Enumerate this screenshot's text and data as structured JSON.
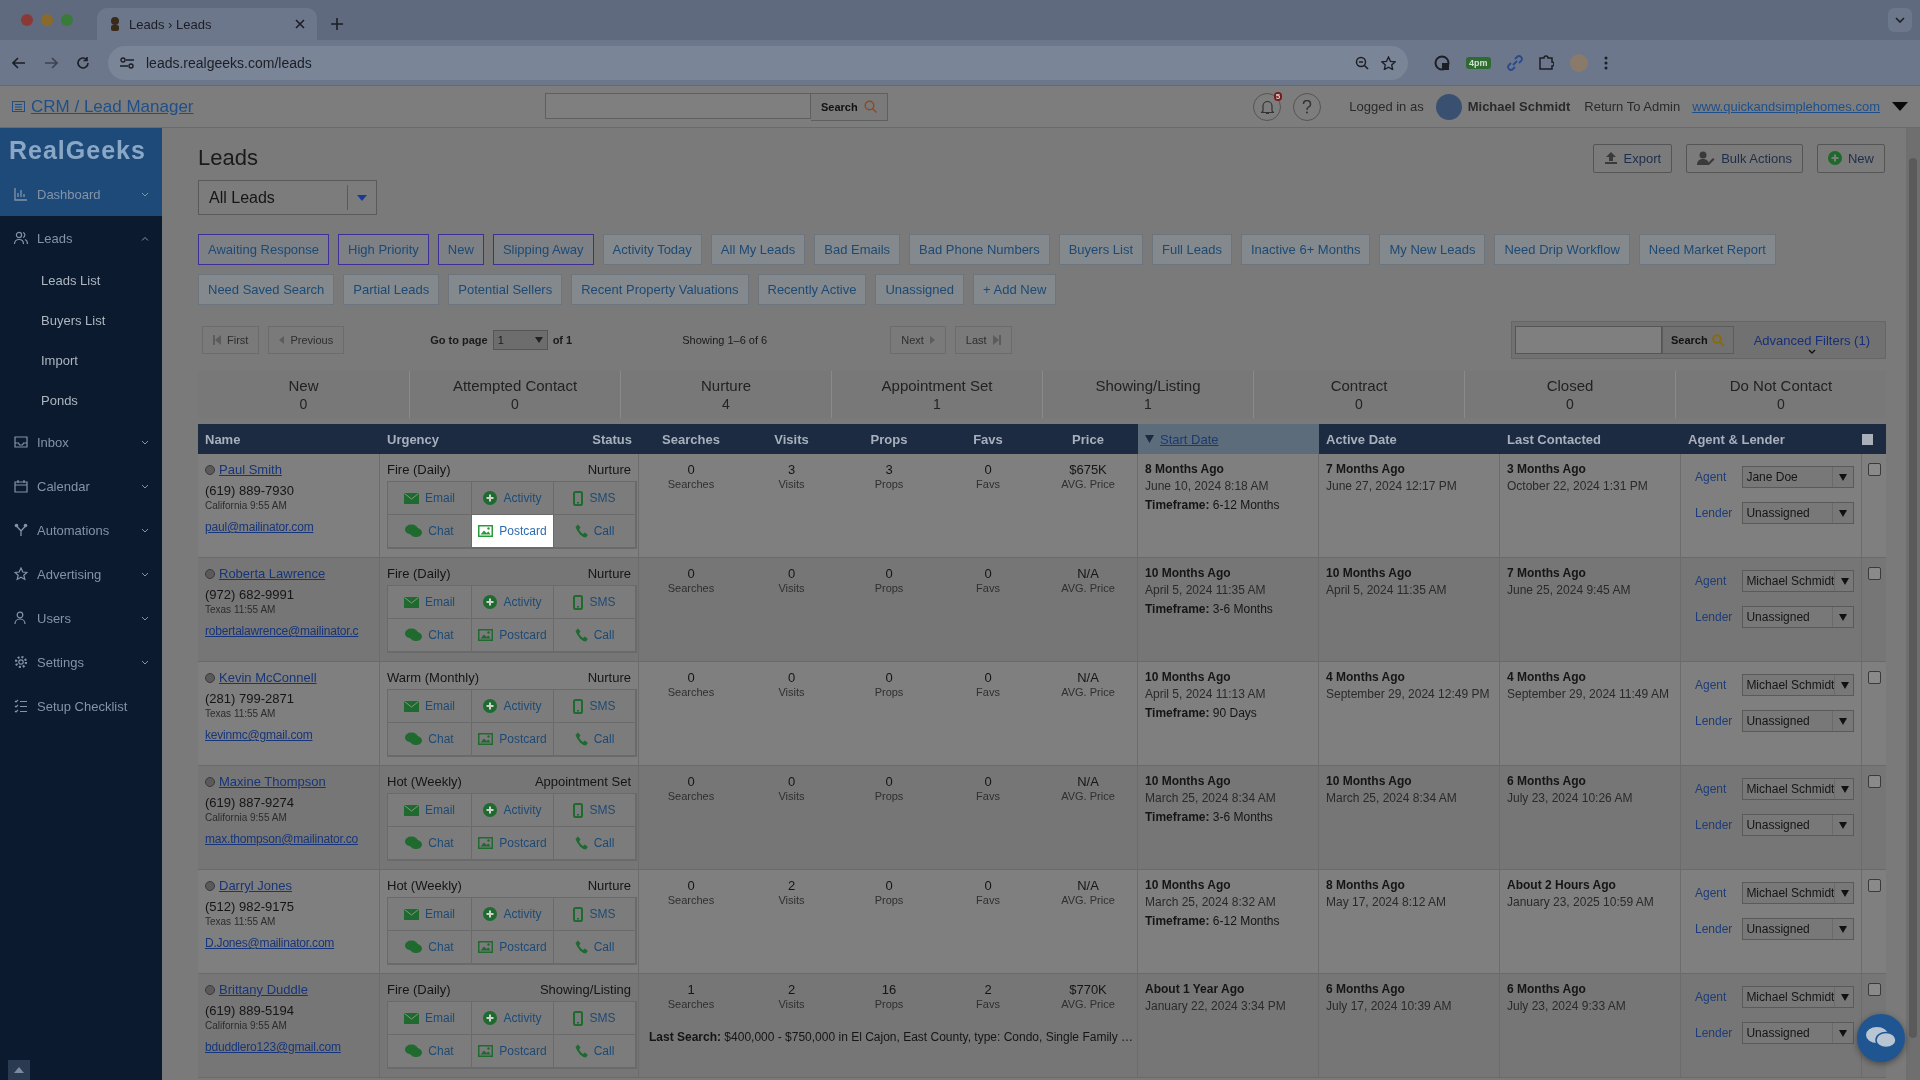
{
  "browser": {
    "tab_title": "Leads › Leads",
    "url": "leads.realgeeks.com/leads",
    "extension_badge": "4pm"
  },
  "header": {
    "title": "CRM / Lead Manager",
    "search_button": "Search",
    "notification_count": "5",
    "logged_in_label": "Logged in as",
    "user_name": "Michael Schmidt",
    "return_link": "Return To Admin",
    "site_link": "www.quickandsimplehomes.com"
  },
  "sidebar": {
    "logo": "RealGeeks",
    "items": [
      {
        "kind": "menu",
        "label": "Dashboard",
        "selected": true,
        "expanded": false
      },
      {
        "kind": "menu",
        "label": "Leads",
        "selected": false,
        "expanded": true,
        "children": [
          {
            "label": "Leads List"
          },
          {
            "label": "Buyers List"
          },
          {
            "label": "Import"
          },
          {
            "label": "Ponds"
          }
        ]
      },
      {
        "kind": "menu",
        "label": "Inbox",
        "selected": false,
        "expanded": false
      },
      {
        "kind": "menu",
        "label": "Calendar",
        "selected": false,
        "expanded": false
      },
      {
        "kind": "menu",
        "label": "Automations",
        "selected": false,
        "expanded": false
      },
      {
        "kind": "menu",
        "label": "Advertising",
        "selected": false,
        "expanded": false
      },
      {
        "kind": "menu",
        "label": "Users",
        "selected": false,
        "expanded": false
      },
      {
        "kind": "menu",
        "label": "Settings",
        "selected": false,
        "expanded": false
      },
      {
        "kind": "link",
        "label": "Setup Checklist",
        "selected": false
      }
    ]
  },
  "page": {
    "title": "Leads",
    "view_select": "All Leads",
    "actions": [
      "Export",
      "Bulk Actions",
      "New"
    ]
  },
  "filters": [
    {
      "label": "Awaiting Response",
      "selected": true
    },
    {
      "label": "High Priority",
      "selected": true
    },
    {
      "label": "New",
      "selected": true
    },
    {
      "label": "Slipping Away",
      "selected": true
    },
    {
      "label": "Activity Today",
      "selected": false
    },
    {
      "label": "All My Leads",
      "selected": false
    },
    {
      "label": "Bad Emails",
      "selected": false
    },
    {
      "label": "Bad Phone Numbers",
      "selected": false
    },
    {
      "label": "Buyers List",
      "selected": false
    },
    {
      "label": "Full Leads",
      "selected": false
    },
    {
      "label": "Inactive 6+ Months",
      "selected": false
    },
    {
      "label": "My New Leads",
      "selected": false
    },
    {
      "label": "Need Drip Workflow",
      "selected": false
    },
    {
      "label": "Need Market Report",
      "selected": false
    },
    {
      "label": "Need Saved Search",
      "selected": false
    },
    {
      "label": "Partial Leads",
      "selected": false
    },
    {
      "label": "Potential Sellers",
      "selected": false
    },
    {
      "label": "Recent Property Valuations",
      "selected": false
    },
    {
      "label": "Recently Active",
      "selected": false
    },
    {
      "label": "Unassigned",
      "selected": false
    }
  ],
  "add_filter": "+ Add New",
  "pagination": {
    "first": "First",
    "previous": "Previous",
    "go_to_page": "Go to page",
    "page": "1",
    "of": "of 1",
    "showing": "Showing 1–6 of 6",
    "next": "Next",
    "last": "Last",
    "search_button": "Search",
    "advanced_filters": "Advanced Filters (1)"
  },
  "stages": [
    {
      "name": "New",
      "count": "0"
    },
    {
      "name": "Attempted Contact",
      "count": "0"
    },
    {
      "name": "Nurture",
      "count": "4"
    },
    {
      "name": "Appointment Set",
      "count": "1"
    },
    {
      "name": "Showing/Listing",
      "count": "1"
    },
    {
      "name": "Contract",
      "count": "0"
    },
    {
      "name": "Closed",
      "count": "0"
    },
    {
      "name": "Do Not Contact",
      "count": "0"
    }
  ],
  "table": {
    "columns": [
      {
        "label": "Name",
        "sorted": false
      },
      {
        "label": "Urgency",
        "sorted": false
      },
      {
        "label": "Status",
        "sorted": false
      },
      {
        "label": "Searches",
        "sorted": false
      },
      {
        "label": "Visits",
        "sorted": false
      },
      {
        "label": "Props",
        "sorted": false
      },
      {
        "label": "Favs",
        "sorted": false
      },
      {
        "label": "Price",
        "sorted": false
      },
      {
        "label": "Start Date",
        "sorted": true
      },
      {
        "label": "Active Date",
        "sorted": false
      },
      {
        "label": "Last Contacted",
        "sorted": false
      },
      {
        "label": "Agent & Lender",
        "sorted": false
      }
    ],
    "select_all_checked": false,
    "rows": [
      {
        "name": "Paul Smith",
        "phone": "(619) 889-7930",
        "location": "California",
        "local_time": "9:55 AM",
        "email": "paul@mailinator.com",
        "urgency": "Fire (Daily)",
        "status": "Nurture",
        "stats": [
          {
            "value": "0",
            "label": "Searches"
          },
          {
            "value": "3",
            "label": "Visits"
          },
          {
            "value": "3",
            "label": "Props"
          },
          {
            "value": "0",
            "label": "Favs"
          },
          {
            "value": "$675K",
            "label": "AVG. Price"
          }
        ],
        "actions": [
          {
            "label": "Email",
            "highlighted": false
          },
          {
            "label": "Activity",
            "highlighted": false
          },
          {
            "label": "SMS",
            "highlighted": false
          },
          {
            "label": "Chat",
            "highlighted": false
          },
          {
            "label": "Postcard",
            "highlighted": true
          },
          {
            "label": "Call",
            "highlighted": false
          }
        ],
        "start": {
          "ago": "8 Months Ago",
          "date": "June 10, 2024 8:18 AM",
          "timeframe": "**Timeframe:** 6-12 Months"
        },
        "active": {
          "ago": "7 Months Ago",
          "date": "June 27, 2024 12:17 PM"
        },
        "contacted": {
          "ago": "3 Months Ago",
          "date": "October 22, 2024 1:31 PM"
        },
        "agent_label": "Agent",
        "agent": "Jane Doe",
        "lender_label": "Lender",
        "lender": "Unassigned",
        "checked": false
      },
      {
        "name": "Roberta Lawrence",
        "phone": "(972) 682-9991",
        "location": "Texas",
        "local_time": "11:55 AM",
        "email": "robertalawrence@mailinator.c",
        "urgency": "Fire (Daily)",
        "status": "Nurture",
        "stats": [
          {
            "value": "0",
            "label": "Searches"
          },
          {
            "value": "0",
            "label": "Visits"
          },
          {
            "value": "0",
            "label": "Props"
          },
          {
            "value": "0",
            "label": "Favs"
          },
          {
            "value": "N/A",
            "label": "AVG. Price"
          }
        ],
        "actions": [
          {
            "label": "Email",
            "highlighted": false
          },
          {
            "label": "Activity",
            "highlighted": false
          },
          {
            "label": "SMS",
            "highlighted": false
          },
          {
            "label": "Chat",
            "highlighted": false
          },
          {
            "label": "Postcard",
            "highlighted": false
          },
          {
            "label": "Call",
            "highlighted": false
          }
        ],
        "start": {
          "ago": "10 Months Ago",
          "date": "April 5, 2024 11:35 AM",
          "timeframe": "**Timeframe:** 3-6 Months"
        },
        "active": {
          "ago": "10 Months Ago",
          "date": "April 5, 2024 11:35 AM"
        },
        "contacted": {
          "ago": "7 Months Ago",
          "date": "June 25, 2024 9:45 AM"
        },
        "agent_label": "Agent",
        "agent": "Michael Schmidt",
        "lender_label": "Lender",
        "lender": "Unassigned",
        "checked": false
      },
      {
        "name": "Kevin McConnell",
        "phone": "(281) 799-2871",
        "location": "Texas",
        "local_time": "11:55 AM",
        "email": "kevinmc@gmail.com",
        "urgency": "Warm (Monthly)",
        "status": "Nurture",
        "stats": [
          {
            "value": "0",
            "label": "Searches"
          },
          {
            "value": "0",
            "label": "Visits"
          },
          {
            "value": "0",
            "label": "Props"
          },
          {
            "value": "0",
            "label": "Favs"
          },
          {
            "value": "N/A",
            "label": "AVG. Price"
          }
        ],
        "actions": [
          {
            "label": "Email",
            "highlighted": false
          },
          {
            "label": "Activity",
            "highlighted": false
          },
          {
            "label": "SMS",
            "highlighted": false
          },
          {
            "label": "Chat",
            "highlighted": false
          },
          {
            "label": "Postcard",
            "highlighted": false
          },
          {
            "label": "Call",
            "highlighted": false
          }
        ],
        "start": {
          "ago": "10 Months Ago",
          "date": "April 5, 2024 11:13 AM",
          "timeframe": "**Timeframe:** 90 Days"
        },
        "active": {
          "ago": "4 Months Ago",
          "date": "September 29, 2024 12:49 PM"
        },
        "contacted": {
          "ago": "4 Months Ago",
          "date": "September 29, 2024 11:49 AM"
        },
        "agent_label": "Agent",
        "agent": "Michael Schmidt",
        "lender_label": "Lender",
        "lender": "Unassigned",
        "checked": false
      },
      {
        "name": "Maxine Thompson",
        "phone": "(619) 887-9274",
        "location": "California",
        "local_time": "9:55 AM",
        "email": "max.thompson@mailinator.co",
        "urgency": "Hot (Weekly)",
        "status": "Appointment Set",
        "stats": [
          {
            "value": "0",
            "label": "Searches"
          },
          {
            "value": "0",
            "label": "Visits"
          },
          {
            "value": "0",
            "label": "Props"
          },
          {
            "value": "0",
            "label": "Favs"
          },
          {
            "value": "N/A",
            "label": "AVG. Price"
          }
        ],
        "actions": [
          {
            "label": "Email",
            "highlighted": false
          },
          {
            "label": "Activity",
            "highlighted": false
          },
          {
            "label": "SMS",
            "highlighted": false
          },
          {
            "label": "Chat",
            "highlighted": false
          },
          {
            "label": "Postcard",
            "highlighted": false
          },
          {
            "label": "Call",
            "highlighted": false
          }
        ],
        "start": {
          "ago": "10 Months Ago",
          "date": "March 25, 2024 8:34 AM",
          "timeframe": "**Timeframe:** 3-6 Months"
        },
        "active": {
          "ago": "10 Months Ago",
          "date": "March 25, 2024 8:34 AM"
        },
        "contacted": {
          "ago": "6 Months Ago",
          "date": "July 23, 2024 10:26 AM"
        },
        "agent_label": "Agent",
        "agent": "Michael Schmidt",
        "lender_label": "Lender",
        "lender": "Unassigned",
        "checked": false
      },
      {
        "name": "Darryl Jones",
        "phone": "(512) 982-9175",
        "location": "Texas",
        "local_time": "11:55 AM",
        "email": "D.Jones@mailinator.com",
        "urgency": "Hot (Weekly)",
        "status": "Nurture",
        "stats": [
          {
            "value": "0",
            "label": "Searches"
          },
          {
            "value": "2",
            "label": "Visits"
          },
          {
            "value": "0",
            "label": "Props"
          },
          {
            "value": "0",
            "label": "Favs"
          },
          {
            "value": "N/A",
            "label": "AVG. Price"
          }
        ],
        "actions": [
          {
            "label": "Email",
            "highlighted": false
          },
          {
            "label": "Activity",
            "highlighted": false
          },
          {
            "label": "SMS",
            "highlighted": false
          },
          {
            "label": "Chat",
            "highlighted": false
          },
          {
            "label": "Postcard",
            "highlighted": false
          },
          {
            "label": "Call",
            "highlighted": false
          }
        ],
        "start": {
          "ago": "10 Months Ago",
          "date": "March 25, 2024 8:32 AM",
          "timeframe": "**Timeframe:** 6-12 Months"
        },
        "active": {
          "ago": "8 Months Ago",
          "date": "May 17, 2024 8:12 AM"
        },
        "contacted": {
          "ago": "About 2 Hours Ago",
          "date": "January 23, 2025 10:59 AM"
        },
        "agent_label": "Agent",
        "agent": "Michael Schmidt",
        "lender_label": "Lender",
        "lender": "Unassigned",
        "checked": false
      },
      {
        "name": "Brittany Duddle",
        "phone": "(619) 889-5194",
        "location": "California",
        "local_time": "9:55 AM",
        "email": "bduddlero123@gmail.com",
        "urgency": "Fire (Daily)",
        "status": "Showing/Listing",
        "stats": [
          {
            "value": "1",
            "label": "Searches"
          },
          {
            "value": "2",
            "label": "Visits"
          },
          {
            "value": "16",
            "label": "Props"
          },
          {
            "value": "2",
            "label": "Favs"
          },
          {
            "value": "$770K",
            "label": "AVG. Price"
          }
        ],
        "actions": [
          {
            "label": "Email",
            "highlighted": false
          },
          {
            "label": "Activity",
            "highlighted": false
          },
          {
            "label": "SMS",
            "highlighted": false
          },
          {
            "label": "Chat",
            "highlighted": false
          },
          {
            "label": "Postcard",
            "highlighted": false
          },
          {
            "label": "Call",
            "highlighted": false
          }
        ],
        "last_search": "**Last Search:** $400,000 - $750,000 in El Cajon, East County, type: Condo, Single Family …",
        "start": {
          "ago": "About 1 Year Ago",
          "date": "January 22, 2024 3:34 PM"
        },
        "active": {
          "ago": "6 Months Ago",
          "date": "July 17, 2024 10:39 AM"
        },
        "contacted": {
          "ago": "6 Months Ago",
          "date": "July 23, 2024 9:33 AM"
        },
        "agent_label": "Agent",
        "agent": "Michael Schmidt",
        "lender_label": "Lender",
        "lender": "Unassigned",
        "checked": false
      }
    ]
  }
}
